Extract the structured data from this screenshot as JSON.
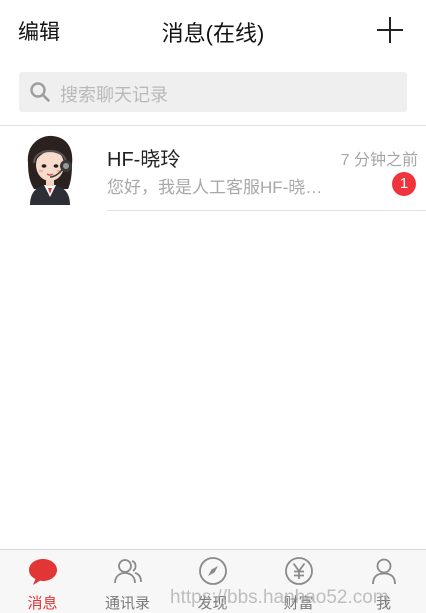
{
  "header": {
    "edit_label": "编辑",
    "title": "消息(在线)",
    "add_icon": "plus-icon"
  },
  "search": {
    "placeholder": "搜索聊天记录",
    "icon": "search-icon"
  },
  "conversations": [
    {
      "name": "HF-晓玲",
      "time": "7 分钟之前",
      "preview": "您好，我是人工客服HF-晓…",
      "unread": "1",
      "avatar": "customer-service-avatar"
    }
  ],
  "tabs": [
    {
      "label": "消息",
      "icon": "chat-bubble-icon",
      "active": true
    },
    {
      "label": "通讯录",
      "icon": "contacts-icon",
      "active": false
    },
    {
      "label": "发现",
      "icon": "compass-icon",
      "active": false
    },
    {
      "label": "财富",
      "icon": "yen-icon",
      "active": false
    },
    {
      "label": "我",
      "icon": "person-icon",
      "active": false
    }
  ],
  "colors": {
    "accent": "#e23535",
    "badge": "#f0343e",
    "inactive_tab": "#7a7a7a"
  },
  "watermark": "https://bbs.hanhao52.com"
}
